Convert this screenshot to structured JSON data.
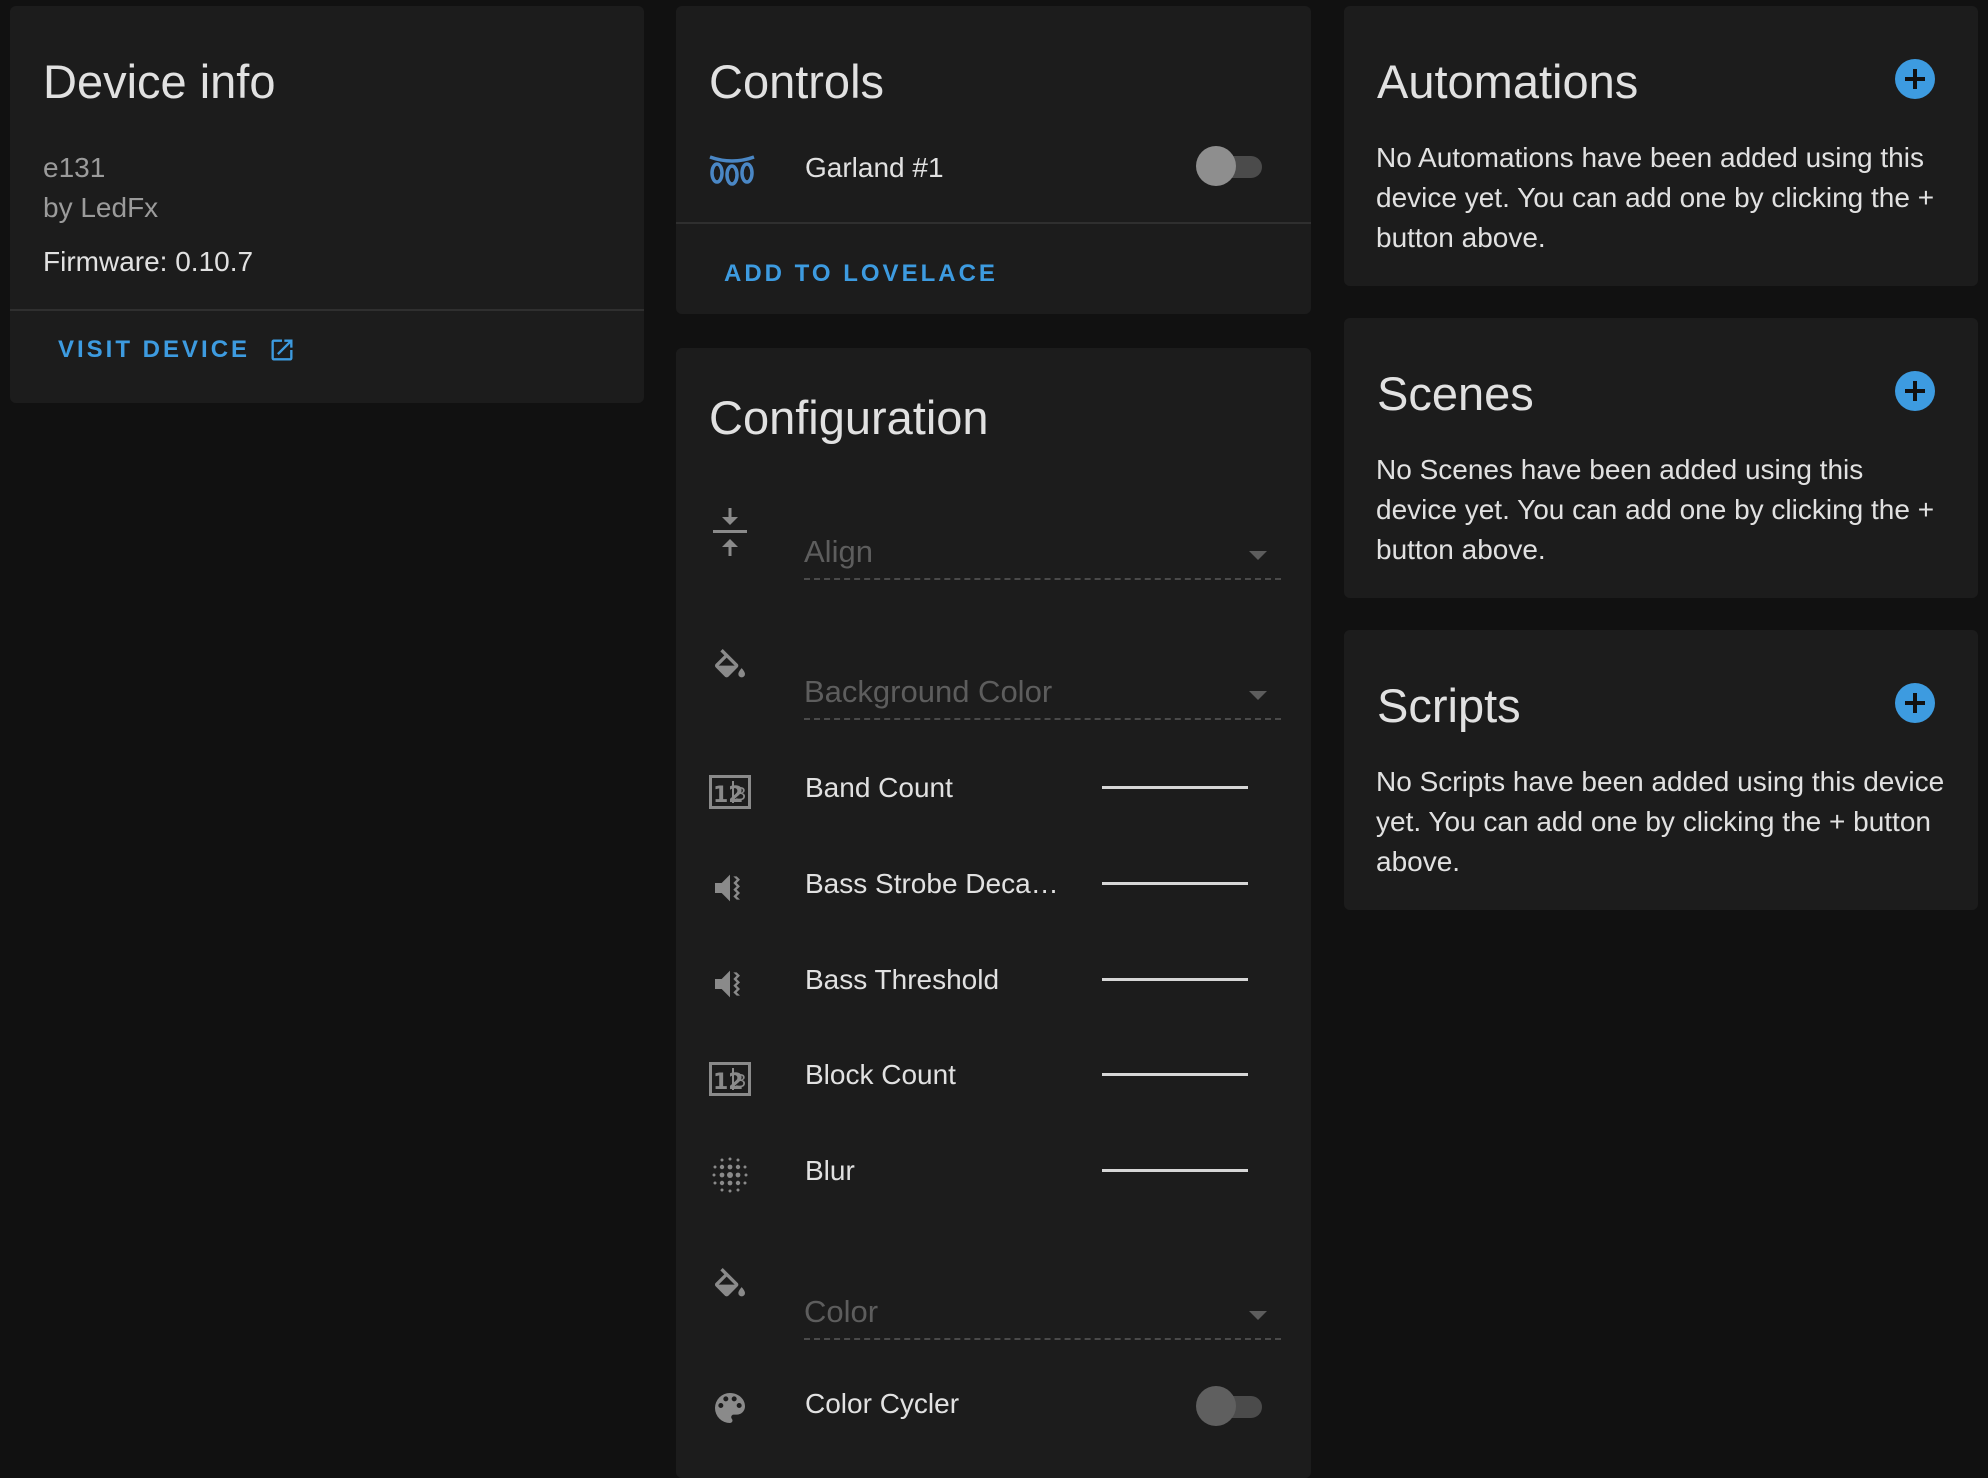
{
  "colors": {
    "accent": "#3d9be0",
    "card": "#1c1c1c",
    "background": "#111111"
  },
  "device_info": {
    "title": "Device info",
    "model": "e131",
    "manufacturer": "by LedFx",
    "firmware": "Firmware: 0.10.7",
    "visit_label": "VISIT DEVICE",
    "visit_icon": "open-in-new-icon"
  },
  "controls": {
    "title": "Controls",
    "entity": {
      "icon": "string-lights-icon",
      "label": "Garland #1",
      "state": "off"
    },
    "add_label": "ADD TO LOVELACE"
  },
  "configuration": {
    "title": "Configuration",
    "align": {
      "icon": "align-vertical-center-icon",
      "placeholder": "Align"
    },
    "background_color": {
      "icon": "format-color-fill-icon",
      "placeholder": "Background Color"
    },
    "band_count": {
      "icon": "numeric-icon",
      "label": "Band Count"
    },
    "bass_strobe": {
      "icon": "volume-vibrate-icon",
      "label": "Bass Strobe Deca…"
    },
    "bass_threshold": {
      "icon": "volume-vibrate-icon",
      "label": "Bass Threshold"
    },
    "block_count": {
      "icon": "numeric-icon",
      "label": "Block Count"
    },
    "blur": {
      "icon": "blur-icon",
      "label": "Blur"
    },
    "color": {
      "icon": "format-color-fill-icon",
      "placeholder": "Color"
    },
    "color_cycler": {
      "icon": "palette-icon",
      "label": "Color Cycler",
      "state": "off"
    }
  },
  "automations": {
    "title": "Automations",
    "text": "No Automations have been added using this device yet. You can add one by clicking the + button above.",
    "add_icon": "plus-circle-icon"
  },
  "scenes": {
    "title": "Scenes",
    "text": "No Scenes have been added using this device yet. You can add one by clicking the + button above.",
    "add_icon": "plus-circle-icon"
  },
  "scripts": {
    "title": "Scripts",
    "text": "No Scripts have been added using this device yet. You can add one by clicking the + button above.",
    "add_icon": "plus-circle-icon"
  }
}
